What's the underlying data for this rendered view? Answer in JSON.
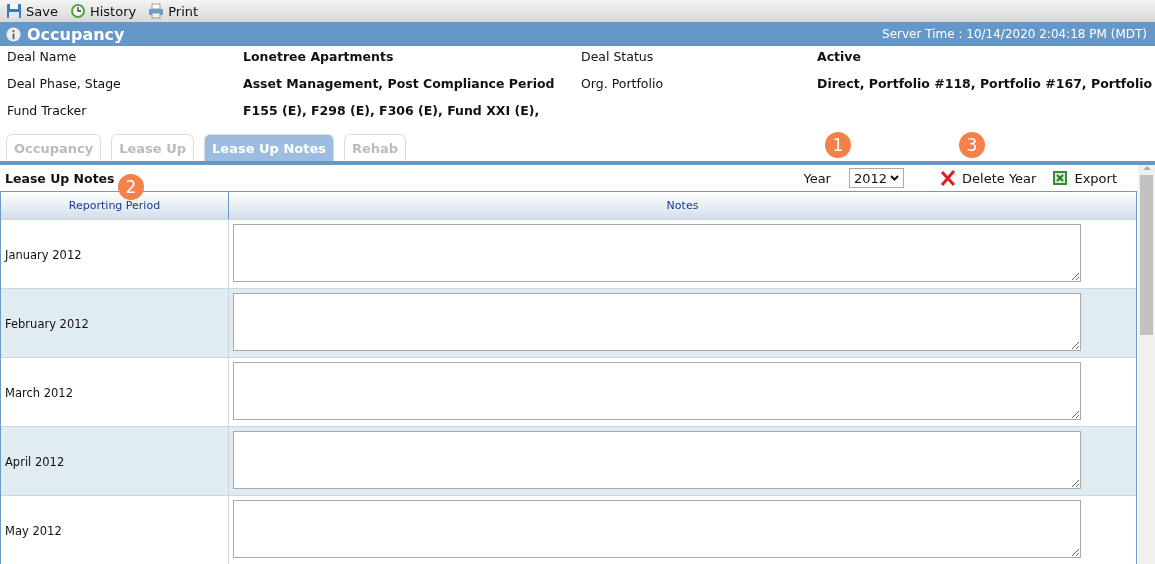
{
  "toolbar": [
    {
      "kind": "save",
      "label": "Save"
    },
    {
      "kind": "history",
      "label": "History"
    },
    {
      "kind": "print",
      "label": "Print"
    }
  ],
  "title_bar": {
    "title": "Occupancy",
    "server_time": "Server Time : 10/14/2020 2:04:18 PM (MDT)"
  },
  "deal_info": [
    {
      "label": "Deal Name",
      "value": "Lonetree Apartments"
    },
    {
      "label": "Deal Status",
      "value": "Active"
    },
    {
      "label": "Deal Phase, Stage",
      "value": "Asset Management, Post Compliance Period"
    },
    {
      "label": "Org. Portfolio",
      "value": "Direct, Portfolio #118, Portfolio #167, Portfolio"
    },
    {
      "label": "Fund Tracker",
      "value": "F155 (E), F298 (E), F306 (E), Fund XXI (E),"
    }
  ],
  "tabs": [
    {
      "label": "Occupancy",
      "selected": false
    },
    {
      "label": "Lease Up",
      "selected": false
    },
    {
      "label": "Lease Up Notes",
      "selected": true
    },
    {
      "label": "Rehab",
      "selected": false
    }
  ],
  "section": {
    "title": "Lease Up Notes",
    "year_label": "Year",
    "year": "2012",
    "actions": [
      {
        "kind": "delete",
        "label": "Delete Year"
      },
      {
        "kind": "export",
        "label": "Export"
      }
    ]
  },
  "table": {
    "columns": [
      "Reporting Period",
      "Notes"
    ],
    "rows": [
      {
        "period": "January 2012"
      },
      {
        "period": "February 2012"
      },
      {
        "period": "March 2012"
      },
      {
        "period": "April 2012"
      },
      {
        "period": "May 2012"
      }
    ]
  },
  "callouts": [
    {
      "number": "1"
    },
    {
      "number": "2"
    },
    {
      "number": "3"
    }
  ]
}
